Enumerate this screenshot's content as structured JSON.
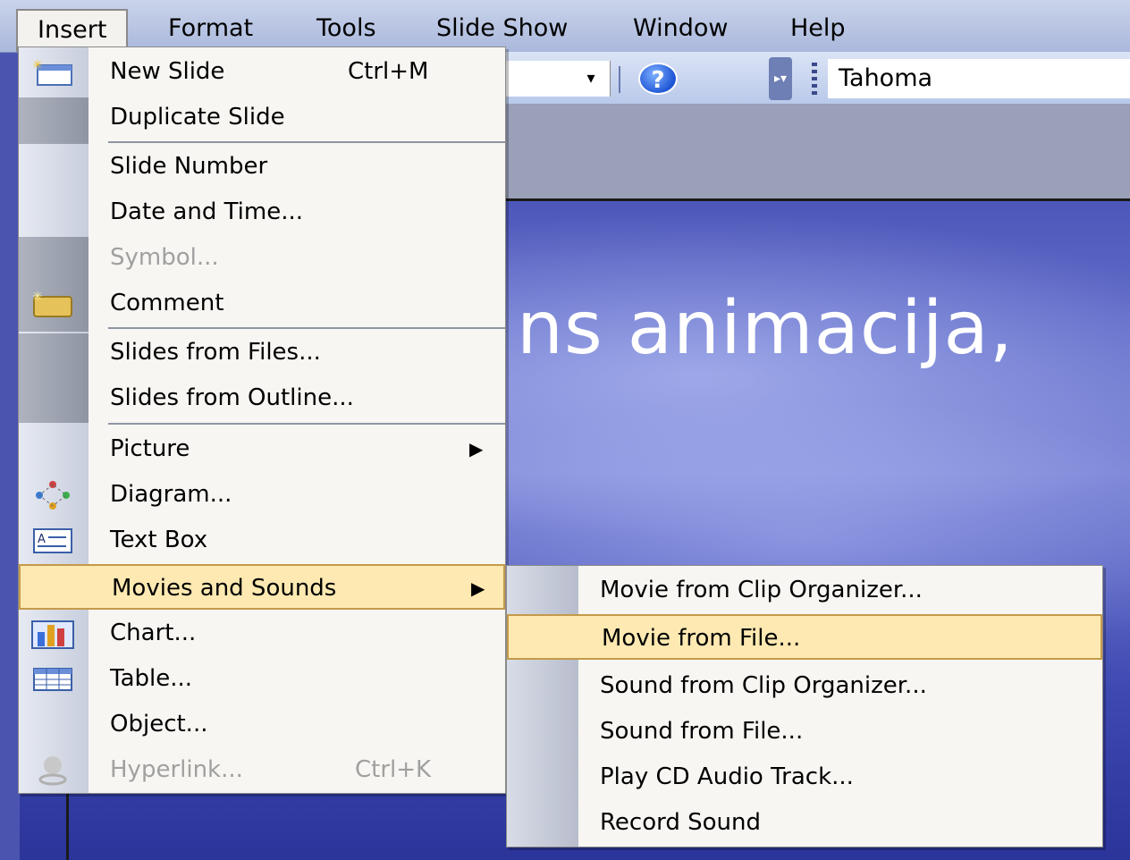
{
  "menubar": {
    "items": [
      {
        "label": "Insert"
      },
      {
        "label": "Format"
      },
      {
        "label": "Tools"
      },
      {
        "label": "Slide Show"
      },
      {
        "label": "Window"
      },
      {
        "label": "Help"
      }
    ]
  },
  "toolbar": {
    "font_name": "Tahoma",
    "help_glyph": "?",
    "dropdown_glyph": "▾",
    "grip_glyph": "▸▾"
  },
  "slide": {
    "title_fragment": "ns animacija,"
  },
  "insert_menu": {
    "items": [
      {
        "label": "New Slide",
        "shortcut": "Ctrl+M",
        "icon": "new-slide-icon"
      },
      {
        "label": "Duplicate Slide"
      },
      {
        "label": "Slide Number"
      },
      {
        "label": "Date and Time..."
      },
      {
        "label": "Symbol...",
        "disabled": true
      },
      {
        "label": "Comment",
        "icon": "comment-icon"
      },
      {
        "label": "Slides from Files..."
      },
      {
        "label": "Slides from Outline..."
      },
      {
        "label": "Picture",
        "submenu": true
      },
      {
        "label": "Diagram...",
        "icon": "diagram-icon"
      },
      {
        "label": "Text Box",
        "icon": "text-box-icon"
      },
      {
        "label": "Movies and Sounds",
        "submenu": true,
        "highlighted": true
      },
      {
        "label": "Chart...",
        "icon": "chart-icon"
      },
      {
        "label": "Table...",
        "icon": "table-icon"
      },
      {
        "label": "Object..."
      },
      {
        "label": "Hyperlink...",
        "shortcut": "Ctrl+K",
        "disabled": true,
        "icon": "hyperlink-icon"
      }
    ],
    "submenu_arrow": "▶"
  },
  "movies_submenu": {
    "items": [
      {
        "label": "Movie from Clip Organizer..."
      },
      {
        "label": "Movie from File...",
        "highlighted": true
      },
      {
        "label": "Sound from Clip Organizer..."
      },
      {
        "label": "Sound from File..."
      },
      {
        "label": "Play CD Audio Track..."
      },
      {
        "label": "Record Sound"
      }
    ]
  },
  "colors": {
    "highlight": "#fde9b1",
    "highlight_border": "#c49a4a",
    "menu_bg": "#f7f6f2",
    "disabled_text": "#a0a0a0"
  }
}
